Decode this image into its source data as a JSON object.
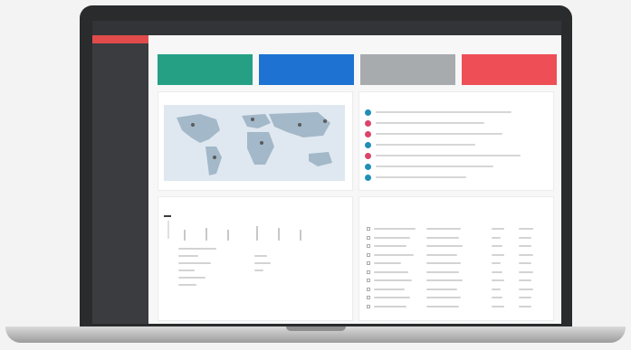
{
  "titlebar": {
    "title": ""
  },
  "sidebar": {
    "items": [
      {
        "label": "",
        "active": true,
        "sub": false
      },
      {
        "label": "",
        "active": false,
        "sub": false
      },
      {
        "label": "",
        "active": false,
        "sub": true
      },
      {
        "label": "",
        "active": false,
        "sub": true
      },
      {
        "label": "",
        "active": false,
        "sub": true
      },
      {
        "label": "",
        "active": false,
        "sub": false
      },
      {
        "label": "",
        "active": false,
        "sub": true
      },
      {
        "label": "",
        "active": false,
        "sub": true
      },
      {
        "label": "",
        "active": false,
        "sub": false
      },
      {
        "label": "",
        "active": false,
        "sub": false
      },
      {
        "label": "",
        "active": false,
        "sub": true
      },
      {
        "label": "",
        "active": false,
        "sub": true
      },
      {
        "label": "",
        "active": false,
        "sub": false
      },
      {
        "label": "",
        "active": false,
        "sub": false
      },
      {
        "label": "",
        "active": false,
        "sub": true
      },
      {
        "label": "",
        "active": false,
        "sub": true
      }
    ]
  },
  "breadcrumb": "",
  "stat_cards": [
    {
      "value": "",
      "label": "",
      "color": "#26a085"
    },
    {
      "value": "",
      "label": "",
      "color": "#1e73d2"
    },
    {
      "value": "",
      "label": "",
      "color": "#a8abae"
    },
    {
      "value": "",
      "label": "",
      "color": "#ee4f56"
    }
  ],
  "map_panel": {
    "title": "",
    "link": ""
  },
  "feed_panel": {
    "title": "",
    "dot_colors": [
      "#1f8fb8",
      "#d9466a",
      "#d9466a",
      "#1f8fb8",
      "#d9466a",
      "#1f8fb8",
      "#1f8fb8"
    ]
  },
  "chart_panel": {
    "title": "",
    "tabs": [
      "",
      "",
      "",
      ""
    ]
  },
  "table_panel": {
    "title": "",
    "columns": [
      "",
      "",
      "",
      ""
    ],
    "row_count": 10
  },
  "colors": {
    "frame": "#2a2b2d",
    "sidebar": "#3b3c3f",
    "sidebar_active": "#e24b4b",
    "map_land": "#a3b8c8",
    "link": "#5b8fd8"
  }
}
